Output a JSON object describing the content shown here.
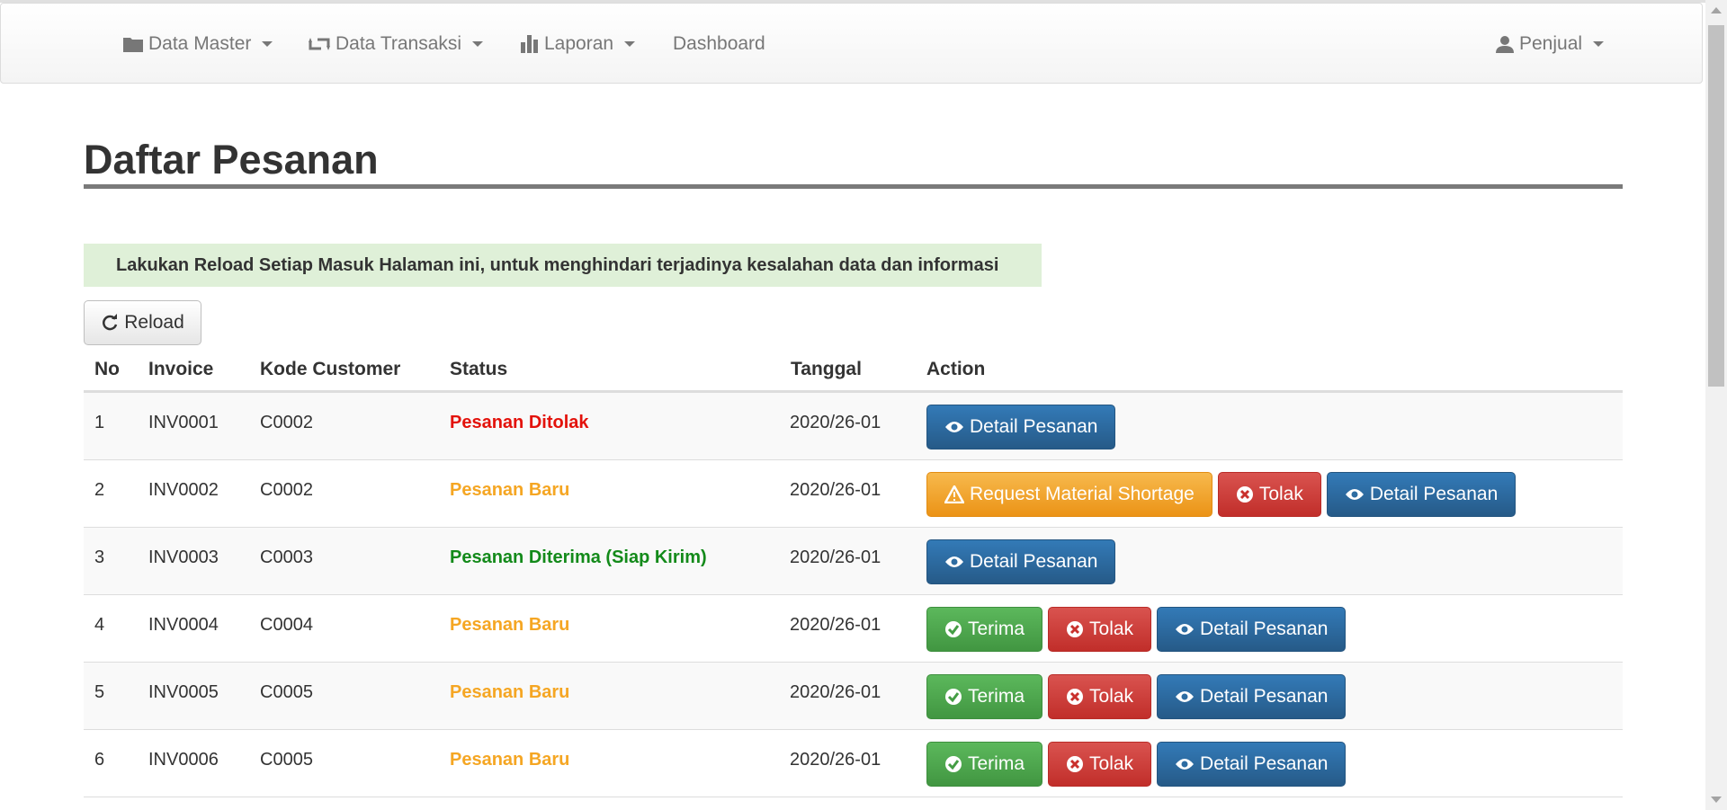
{
  "nav": {
    "data_master": "Data Master",
    "data_transaksi": "Data Transaksi",
    "laporan": "Laporan",
    "dashboard": "Dashboard",
    "user": "Penjual"
  },
  "page_title": "Daftar Pesanan",
  "alert_text": "Lakukan Reload Setiap Masuk Halaman ini, untuk menghindari terjadinya kesalahan data dan informasi",
  "reload_label": "Reload",
  "table": {
    "headers": [
      "No",
      "Invoice",
      "Kode Customer",
      "Status",
      "Tanggal",
      "Action"
    ],
    "rows": [
      {
        "no": "1",
        "invoice": "INV0001",
        "customer": "C0002",
        "status": "Pesanan Ditolak",
        "tanggal": "2020/26-01"
      },
      {
        "no": "2",
        "invoice": "INV0002",
        "customer": "C0002",
        "status": "Pesanan Baru",
        "tanggal": "2020/26-01"
      },
      {
        "no": "3",
        "invoice": "INV0003",
        "customer": "C0003",
        "status": "Pesanan Diterima (Siap Kirim)",
        "tanggal": "2020/26-01"
      },
      {
        "no": "4",
        "invoice": "INV0004",
        "customer": "C0004",
        "status": "Pesanan Baru",
        "tanggal": "2020/26-01"
      },
      {
        "no": "5",
        "invoice": "INV0005",
        "customer": "C0005",
        "status": "Pesanan Baru",
        "tanggal": "2020/26-01"
      },
      {
        "no": "6",
        "invoice": "INV0006",
        "customer": "C0005",
        "status": "Pesanan Baru",
        "tanggal": "2020/26-01"
      }
    ]
  },
  "buttons": {
    "detail": "Detail Pesanan",
    "tolak": "Tolak",
    "terima": "Terima",
    "request": "Request Material Shortage"
  },
  "colors": {
    "status_ditolak": "#e3120b",
    "status_baru": "#f5a623",
    "status_diterima": "#138a1a"
  }
}
